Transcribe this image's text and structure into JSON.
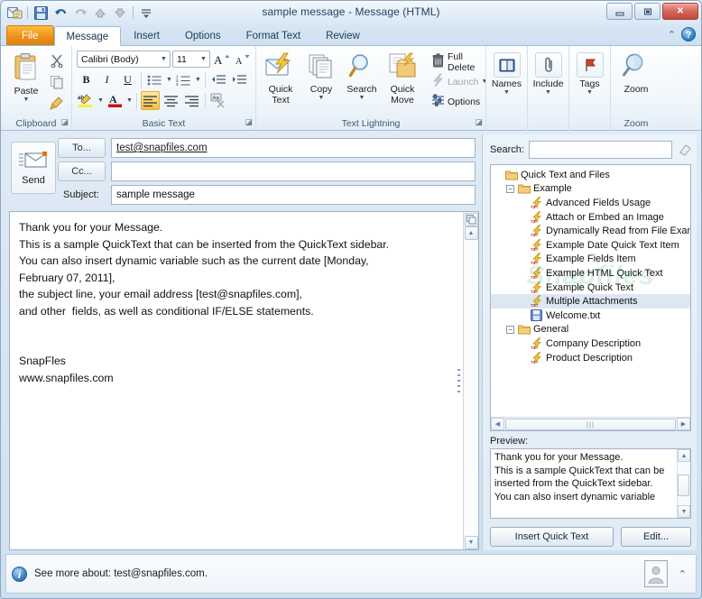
{
  "window": {
    "title": "sample message  -  Message (HTML)",
    "quick_access": [
      {
        "name": "outlook-envelope-icon",
        "label": ""
      },
      {
        "name": "save-icon",
        "label": ""
      },
      {
        "name": "undo-icon",
        "label": ""
      },
      {
        "name": "redo-icon",
        "label": ""
      },
      {
        "name": "previous-item-icon",
        "label": ""
      },
      {
        "name": "next-item-icon",
        "label": ""
      },
      {
        "name": "customize-quick-access-toolbar-icon",
        "label": ""
      }
    ],
    "controls": {
      "minimize": "–",
      "restore": "□",
      "close": "✕"
    }
  },
  "tabs": {
    "file": "File",
    "items": [
      "Message",
      "Insert",
      "Options",
      "Format Text",
      "Review"
    ],
    "active": "Message",
    "collapse_label": "⌃",
    "help_label": "?"
  },
  "ribbon": {
    "groups": [
      {
        "label": "Clipboard",
        "paste": "Paste",
        "cut": "",
        "copy": "",
        "format_painter": ""
      },
      {
        "label": "Basic Text",
        "font_name": "Calibri (Body)",
        "font_size": "11",
        "grow_font": "A",
        "shrink_font": "A",
        "bold": "B",
        "italic": "I",
        "underline": "U",
        "bullets": "",
        "numbering": "",
        "decrease_indent": "",
        "increase_indent": "",
        "highlight": "ab",
        "font_color": "A",
        "align_left": "",
        "align_center": "",
        "align_right": "",
        "clear_formatting": "Aa"
      },
      {
        "label": "Text Lightning",
        "quick_text": "Quick\nText",
        "copy": "Copy",
        "search": "Search",
        "quick_move": "Quick\nMove",
        "full_delete": "Full Delete",
        "launch": "Launch",
        "options": "Options"
      },
      {
        "label": "",
        "names": "Names"
      },
      {
        "label": "",
        "include": "Include"
      },
      {
        "label": "",
        "tags": "Tags"
      },
      {
        "label": "Zoom",
        "zoom": "Zoom"
      }
    ],
    "labels": {
      "clipboard": "Clipboard",
      "basic_text": "Basic Text",
      "text_lightning": "Text Lightning",
      "zoom_group": "Zoom"
    },
    "buttons": {
      "paste": "Paste",
      "quick_text": "Quick Text",
      "quick_text_l1": "Quick",
      "quick_text_l2": "Text",
      "copy": "Copy",
      "search": "Search",
      "quick_move_l1": "Quick",
      "quick_move_l2": "Move",
      "full_delete": "Full Delete",
      "launch": "Launch",
      "options": "Options",
      "names": "Names",
      "include": "Include",
      "tags": "Tags",
      "zoom": "Zoom"
    },
    "font_name": "Calibri (Body)",
    "font_size": "11"
  },
  "compose": {
    "send_label": "Send",
    "to_label": "To...",
    "cc_label": "Cc...",
    "subject_label": "Subject:",
    "to_value": "test@snapfiles.com",
    "cc_value": "",
    "subject_value": "sample message",
    "body": "Thank you for your Message.\nThis is a sample QuickText that can be inserted from the QuickText sidebar.\nYou can also insert dynamic variable such as the current date [Monday,\nFebruary 07, 2011],\nthe subject line, your email address [test@snapfiles.com],\nand other  fields, as well as conditional IF/ELSE statements.\n\n\nSnapFles\nwww.snapfiles.com"
  },
  "sidebar": {
    "search_label": "Search:",
    "search_value": "",
    "eraser_icon": "eraser-icon",
    "watermark": "Snapfiles",
    "tree": [
      {
        "label": "Quick Text and Files",
        "type": "folder",
        "indent": 0,
        "expander": "",
        "selected": false
      },
      {
        "label": "Example",
        "type": "folder",
        "indent": 1,
        "expander": "−",
        "selected": false
      },
      {
        "label": "Advanced Fields Usage",
        "type": "quicktext",
        "indent": 2,
        "expander": "",
        "selected": false
      },
      {
        "label": "Attach or Embed an Image",
        "type": "quicktext",
        "indent": 2,
        "expander": "",
        "selected": false
      },
      {
        "label": "Dynamically Read from File Exam",
        "type": "quicktext",
        "indent": 2,
        "expander": "",
        "selected": false
      },
      {
        "label": "Example Date Quick Text Item",
        "type": "quicktext",
        "indent": 2,
        "expander": "",
        "selected": false
      },
      {
        "label": "Example Fields Item",
        "type": "quicktext",
        "indent": 2,
        "expander": "",
        "selected": false
      },
      {
        "label": "Example HTML Quick Text",
        "type": "quicktext",
        "indent": 2,
        "expander": "",
        "selected": false
      },
      {
        "label": "Example Quick Text",
        "type": "quicktext",
        "indent": 2,
        "expander": "",
        "selected": false
      },
      {
        "label": "Multiple Attachments",
        "type": "quicktext",
        "indent": 2,
        "expander": "",
        "selected": true
      },
      {
        "label": "Welcome.txt",
        "type": "file",
        "indent": 2,
        "expander": "",
        "selected": false
      },
      {
        "label": "General",
        "type": "folder",
        "indent": 1,
        "expander": "−",
        "selected": false
      },
      {
        "label": "Company Description",
        "type": "quicktext",
        "indent": 2,
        "expander": "",
        "selected": false
      },
      {
        "label": "Product Description",
        "type": "quicktext",
        "indent": 2,
        "expander": "",
        "selected": false
      }
    ],
    "preview_label": "Preview:",
    "preview_text": "Thank you for your Message.\nThis is a sample QuickText that can be\ninserted from the QuickText sidebar.\nYou can also insert dynamic variable",
    "insert_button": "Insert Quick Text",
    "edit_button": "Edit..."
  },
  "status": {
    "text": "See more about: test@snapfiles.com.",
    "chevron": "⌃"
  },
  "colors": {
    "file_tab": "#f0961d",
    "accent_blue": "#2b7bc4",
    "close_red": "#c0483c",
    "selection": "#8cafd7"
  }
}
